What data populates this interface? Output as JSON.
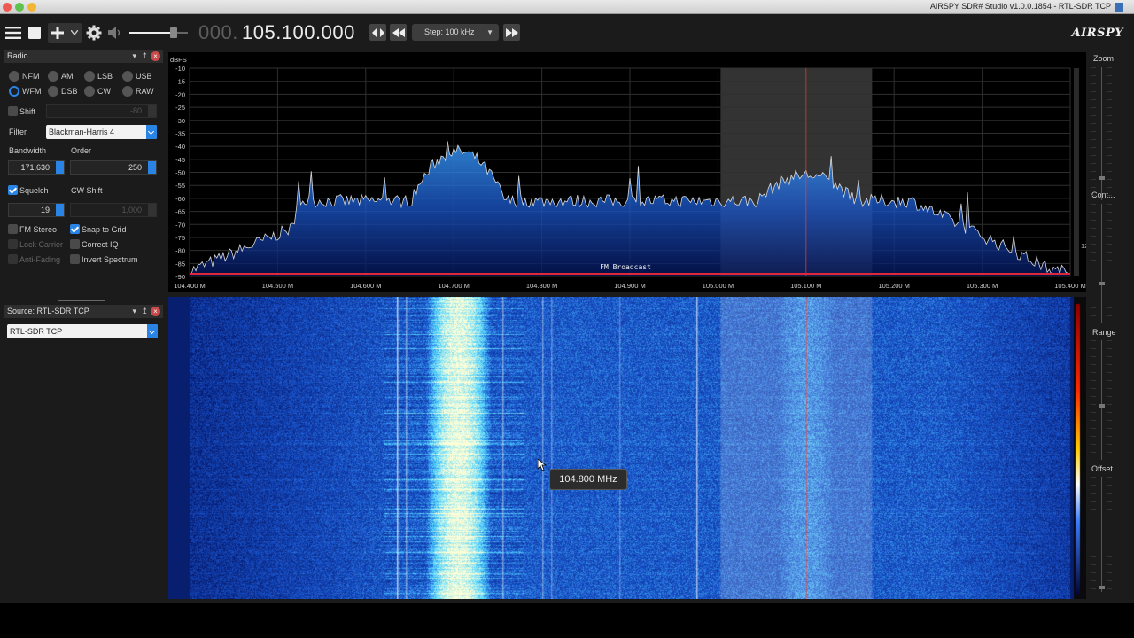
{
  "window": {
    "title": "AIRSPY SDR# Studio v1.0.0.1854 - RTL-SDR TCP"
  },
  "toolbar": {
    "freq_prefix": "000.",
    "freq_value": "105.100.000",
    "step_label": "Step: 100 kHz",
    "logo": "AIRSPY"
  },
  "radio_panel": {
    "title": "Radio",
    "modes": [
      {
        "label": "NFM",
        "selected": false
      },
      {
        "label": "AM",
        "selected": false
      },
      {
        "label": "LSB",
        "selected": false
      },
      {
        "label": "USB",
        "selected": false
      },
      {
        "label": "WFM",
        "selected": true
      },
      {
        "label": "DSB",
        "selected": false
      },
      {
        "label": "CW",
        "selected": false
      },
      {
        "label": "RAW",
        "selected": false
      }
    ],
    "shift_label": "Shift",
    "shift_value": "-80",
    "filter_label": "Filter",
    "filter_value": "Blackman-Harris 4",
    "bandwidth_label": "Bandwidth",
    "bandwidth_value": "171,630",
    "order_label": "Order",
    "order_value": "250",
    "squelch_label": "Squelch",
    "squelch_value": "19",
    "cw_shift_label": "CW Shift",
    "cw_shift_value": "1,000",
    "fm_stereo_label": "FM Stereo",
    "snap_label": "Snap to Grid",
    "lock_carrier_label": "Lock Carrier",
    "correct_iq_label": "Correct IQ",
    "anti_fading_label": "Anti-Fading",
    "invert_spectrum_label": "Invert Spectrum"
  },
  "source_panel": {
    "title": "Source: RTL-SDR TCP",
    "source_value": "RTL-SDR TCP"
  },
  "spectrum": {
    "unit_label": "dBFS",
    "y_ticks": [
      "-10",
      "-15",
      "-20",
      "-25",
      "-30",
      "-35",
      "-40",
      "-45",
      "-50",
      "-55",
      "-60",
      "-65",
      "-70",
      "-75",
      "-80",
      "-85",
      "-90"
    ],
    "x_ticks": [
      "104.400 M",
      "104.500 M",
      "104.600 M",
      "104.700 M",
      "104.800 M",
      "104.900 M",
      "105.000 M",
      "105.100 M",
      "105.200 M",
      "105.300 M",
      "105.400 M"
    ],
    "band_label": "FM Broadcast",
    "right_value": "12"
  },
  "right_panel": {
    "zoom_label": "Zoom",
    "contrast_label": "Cont...",
    "range_label": "Range",
    "offset_label": "Offset"
  },
  "tooltip": {
    "text": "104.800 MHz"
  },
  "colors": {
    "accent": "#2a84e6",
    "center_line": "#ff3b2f",
    "band_line": "#e0263a",
    "trace": "#d9d9d9"
  }
}
